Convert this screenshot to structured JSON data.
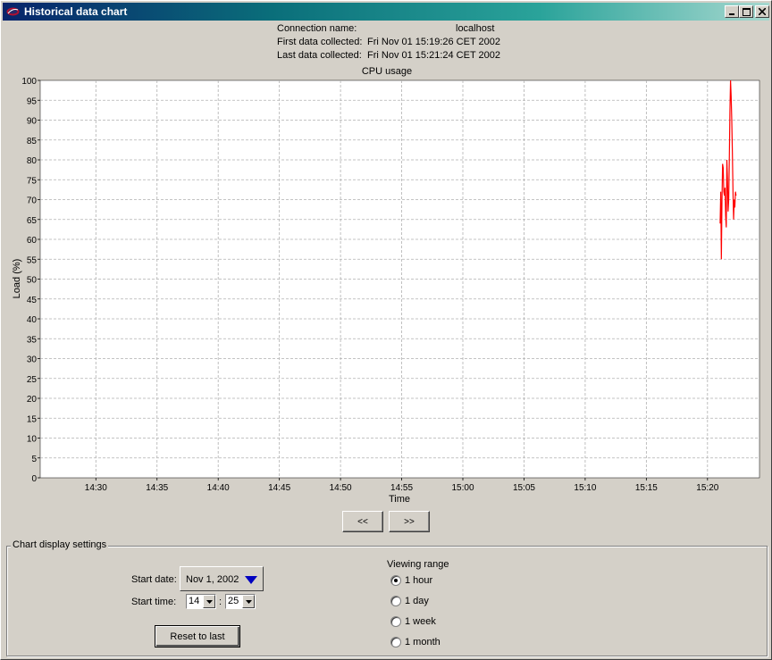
{
  "window": {
    "title": "Historical data chart"
  },
  "info": {
    "connection_label": "Connection name:",
    "connection_value": "localhost",
    "first_label": "First data collected:",
    "first_value": "Fri Nov 01 15:19:26 CET 2002",
    "last_label": "Last data collected:",
    "last_value": "Fri Nov 01 15:21:24 CET 2002"
  },
  "nav": {
    "prev_label": "<<",
    "next_label": ">>"
  },
  "settings": {
    "group_title": "Chart display settings",
    "start_date_label": "Start date:",
    "start_date_value": "Nov 1, 2002",
    "start_time_label": "Start time:",
    "start_hour": "14",
    "time_sep": ":",
    "start_minute": "25",
    "reset_label": "Reset to last",
    "range_title": "Viewing range",
    "range_options": [
      "1 hour",
      "1 day",
      "1 week",
      "1 month"
    ],
    "range_selected": "1 hour"
  },
  "colors": {
    "series": "#ff0000",
    "title_gradient_start": "#08246b",
    "title_gradient_end": "#a6d8cf",
    "date_arrow": "#0000c0"
  },
  "chart_data": {
    "type": "line",
    "title": "CPU usage",
    "xlabel": "Time",
    "ylabel": "Load (%)",
    "xlim": [
      "14:25:27",
      "15:24:15"
    ],
    "ylim": [
      0,
      100
    ],
    "grid": true,
    "x_ticks": [
      "14:30",
      "14:35",
      "14:40",
      "14:45",
      "14:50",
      "14:55",
      "15:00",
      "15:05",
      "15:10",
      "15:15",
      "15:20"
    ],
    "y_ticks": [
      0,
      5,
      10,
      15,
      20,
      25,
      30,
      35,
      40,
      45,
      50,
      55,
      60,
      65,
      70,
      75,
      80,
      85,
      90,
      95,
      100
    ],
    "series": [
      {
        "x": [
          "15:21:02",
          "15:21:05",
          "15:21:08",
          "15:21:11",
          "15:21:14",
          "15:21:17",
          "15:21:20",
          "15:21:23",
          "15:21:26",
          "15:21:29",
          "15:21:32",
          "15:21:35",
          "15:21:38",
          "15:21:41",
          "15:21:44",
          "15:21:47",
          "15:21:50",
          "15:21:53",
          "15:21:56",
          "15:21:59",
          "15:22:02",
          "15:22:05",
          "15:22:08",
          "15:22:11",
          "15:22:14",
          "15:22:17",
          "15:22:20"
        ],
        "values": [
          64,
          72,
          55,
          70,
          79,
          78,
          72,
          71,
          73,
          66,
          63,
          80,
          75,
          67,
          70,
          80,
          92,
          100,
          96,
          90,
          82,
          72,
          65,
          70,
          68,
          72,
          71
        ]
      }
    ]
  }
}
